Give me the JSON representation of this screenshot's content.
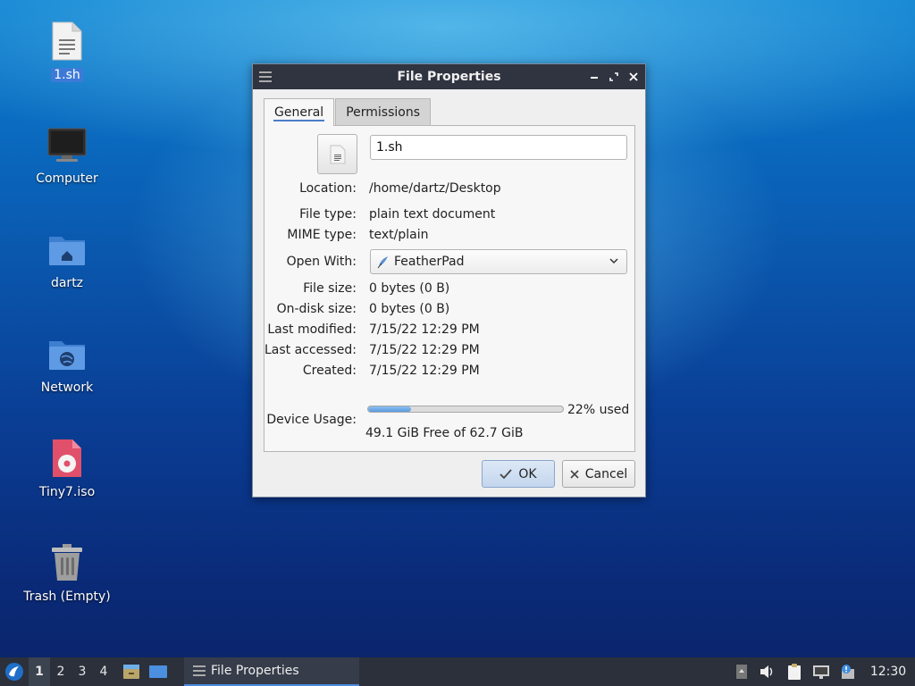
{
  "desktop": {
    "icons": [
      {
        "label": "1.sh"
      },
      {
        "label": "Computer"
      },
      {
        "label": "dartz"
      },
      {
        "label": "Network"
      },
      {
        "label": "Tiny7.iso"
      },
      {
        "label": "Trash (Empty)"
      }
    ]
  },
  "dialog": {
    "title": "File Properties",
    "tabs": [
      {
        "label": "General"
      },
      {
        "label": "Permissions"
      }
    ],
    "filename": "1.sh",
    "location": {
      "label": "Location:",
      "value": "/home/dartz/Desktop"
    },
    "file_type": {
      "label": "File type:",
      "value": "plain text document"
    },
    "mime_type": {
      "label": "MIME type:",
      "value": "text/plain"
    },
    "open_with": {
      "label": "Open With:",
      "value": "FeatherPad"
    },
    "file_size": {
      "label": "File size:",
      "value": "0 bytes (0 B)"
    },
    "on_disk_size": {
      "label": "On-disk size:",
      "value": "0 bytes (0 B)"
    },
    "last_modified": {
      "label": "Last modified:",
      "value": "7/15/22 12:29 PM"
    },
    "last_accessed": {
      "label": "Last accessed:",
      "value": "7/15/22 12:29 PM"
    },
    "created": {
      "label": "Created:",
      "value": "7/15/22 12:29 PM"
    },
    "device_usage": {
      "label": "Device Usage:",
      "percent_text": "22% used",
      "fraction": 0.22,
      "free_text": "49.1 GiB Free of 62.7 GiB"
    },
    "ok_label": "OK",
    "cancel_label": "Cancel"
  },
  "taskbar": {
    "workspaces": [
      "1",
      "2",
      "3",
      "4"
    ],
    "active_workspace": "1",
    "window_title": "File Properties",
    "clock": "12:30"
  },
  "colors": {
    "accent": "#4a7cc9",
    "titlebar": "#2f3440",
    "taskbar": "#2b303b"
  }
}
